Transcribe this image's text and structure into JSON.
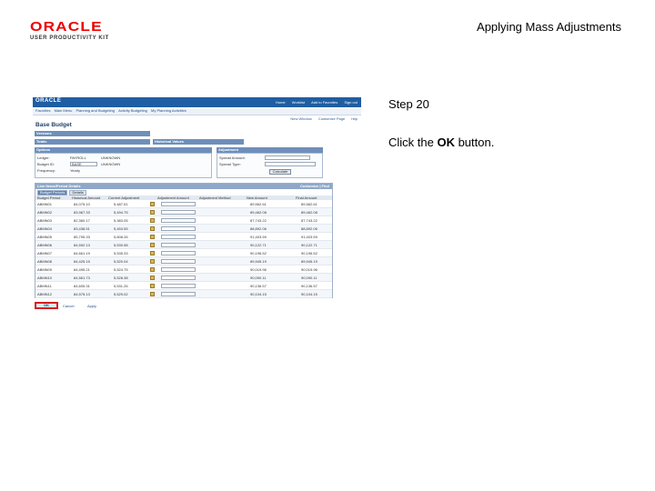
{
  "slide": {
    "title": "Applying Mass Adjustments",
    "step": "Step 20",
    "instruction_prefix": "Click the ",
    "instruction_bold": "OK",
    "instruction_suffix": " button."
  },
  "logo": {
    "brand": "ORACLE",
    "product": "USER PRODUCTIVITY KIT"
  },
  "screenshot": {
    "app_logo": "ORACLE",
    "header_links": [
      "Home",
      "Worklist",
      "Add to Favorites",
      "Sign out"
    ],
    "nav": [
      "Favorites",
      "Main Menu",
      "Planning and Budgeting",
      "Activity Budgeting",
      "My Planning Activities"
    ],
    "toolbar": [
      "New Window",
      "Customize Page",
      "http"
    ],
    "page_title": "Base Budget",
    "bars": {
      "versions": "Versions",
      "totals": "Totals",
      "historical": "Historical Values",
      "options": "Options",
      "adjustment": "Adjustment"
    },
    "options": {
      "rows": [
        {
          "label": "Ledger:",
          "value": "PAYROLL",
          "desc": "UNKNOWN"
        },
        {
          "label": "Budget ID:",
          "value": "BASE",
          "desc": "UNKNOWN"
        },
        {
          "label": "Frequency:",
          "value": "Yearly"
        }
      ]
    },
    "adjustment": {
      "rows": [
        {
          "label": "Spread Amount:"
        },
        {
          "label": "Spread Type:"
        }
      ],
      "calc_label": "Calculate"
    },
    "grid": {
      "title": "Line Items/Period Details",
      "right_link": "Customize | Find",
      "tabs": [
        "Budget Periods",
        "Details"
      ],
      "headers": [
        "Budget Period",
        "Historical Amount",
        "Current Adjustment",
        "Adjustment Amount",
        "Adjustment Method",
        "New Amount",
        "Final Amount"
      ],
      "rows": [
        [
          "ABMN01",
          "84,075.10",
          "5,487.51",
          "",
          "",
          "89,562.61",
          "89,562.61"
        ],
        [
          "ABMN02",
          "83,967.33",
          "5,494.75",
          "",
          "",
          "89,462.08",
          "89,462.08"
        ],
        [
          "ABMN03",
          "82,360.17",
          "5,383.05",
          "",
          "",
          "87,743.22",
          "87,743.22"
        ],
        [
          "ABMN04",
          "83,438.51",
          "5,453.55",
          "",
          "",
          "88,892.06",
          "88,892.06"
        ],
        [
          "ABMN05",
          "85,795.33",
          "5,608.26",
          "",
          "",
          "91,403.59",
          "91,403.59"
        ],
        [
          "ABMN06",
          "84,592.13",
          "5,530.58",
          "",
          "",
          "90,122.71",
          "90,122.71"
        ],
        [
          "ABMN07",
          "84,661.19",
          "5,535.33",
          "",
          "",
          "90,196.52",
          "90,196.52"
        ],
        [
          "ABMN08",
          "84,425.15",
          "5,520.04",
          "",
          "",
          "89,945.19",
          "89,945.19"
        ],
        [
          "ABMN09",
          "84,495.21",
          "5,524.75",
          "",
          "",
          "90,019.96",
          "90,019.96"
        ],
        [
          "ABMN10",
          "84,561.73",
          "5,528.38",
          "",
          "",
          "90,090.11",
          "90,090.11"
        ],
        [
          "ABMN11",
          "84,605.31",
          "5,531.26",
          "",
          "",
          "90,136.57",
          "90,136.57"
        ],
        [
          "ABMN12",
          "84,575.13",
          "5,529.02",
          "",
          "",
          "90,104.15",
          "90,104.15"
        ]
      ]
    },
    "buttons": {
      "ok": "OK",
      "cancel": "Cancel",
      "apply": "Apply"
    }
  },
  "colors": {
    "header": "#1f5ea2",
    "ok_highlight": "#d61f1f"
  }
}
